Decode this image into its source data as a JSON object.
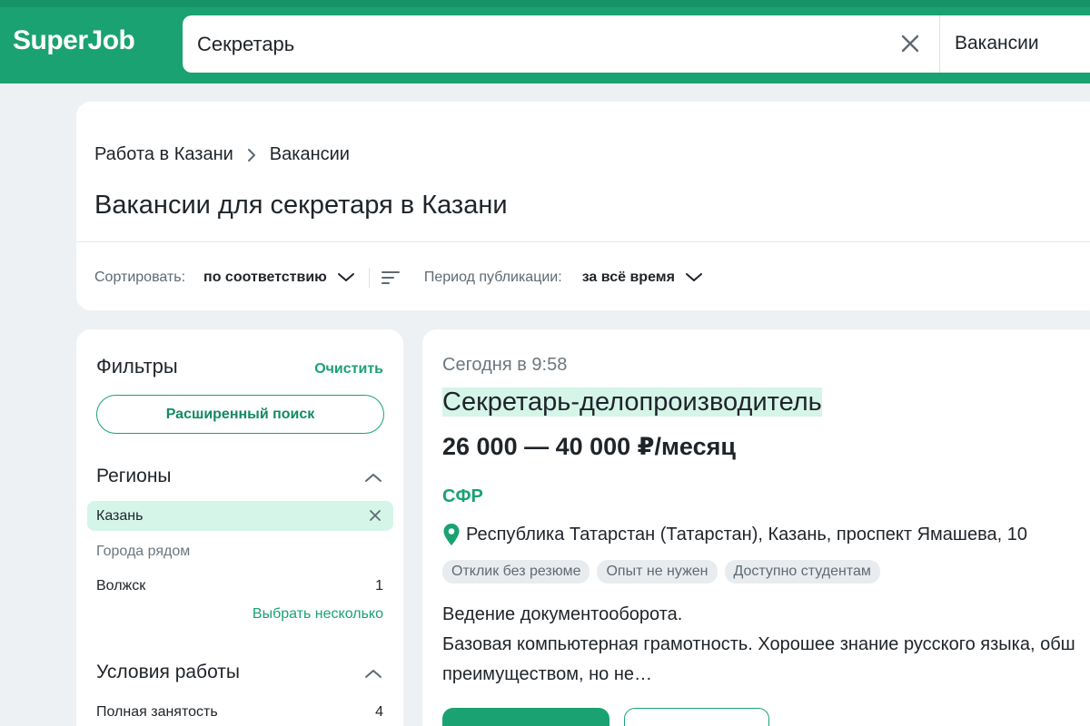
{
  "header": {
    "logo": "SuperJob",
    "search_value": "Секретарь",
    "search_type": "Вакансии"
  },
  "breadcrumb": {
    "items": [
      "Работа в Казани",
      "Вакансии"
    ]
  },
  "page_title": "Вакансии для секретаря в Казани",
  "sort": {
    "label": "Сортировать:",
    "value": "по соответствию",
    "period_label": "Период публикации:",
    "period_value": "за всё время"
  },
  "filters": {
    "title": "Фильтры",
    "clear": "Очистить",
    "advanced_search": "Расширенный поиск",
    "regions": {
      "title": "Регионы",
      "selected": "Казань",
      "nearby_label": "Города рядом",
      "cities": [
        {
          "name": "Волжск",
          "count": "1"
        }
      ],
      "choose_multiple": "Выбрать несколько"
    },
    "conditions": {
      "title": "Условия работы",
      "items": [
        {
          "name": "Полная занятость",
          "count": "4"
        }
      ]
    }
  },
  "vacancy": {
    "date": "Сегодня в 9:58",
    "title_part1": "Секретарь",
    "title_part2": "-делопроизводитель",
    "salary": "26 000 — 40 000 ₽/месяц",
    "company": "СФР",
    "address": "Республика Татарстан (Татарстан), Казань, проспект Ямашева, 10",
    "tags": [
      "Отклик без резюме",
      "Опыт не нужен",
      "Доступно студентам"
    ],
    "description_line1": "Ведение документооборота.",
    "description_line2": "Базовая компьютерная грамотность. Хорошее знание русского языка, обш",
    "description_line3": "преимуществом, но не…"
  },
  "colors": {
    "brand_green": "#1aa272",
    "highlight": "#d5f5e9",
    "background": "#eef1f3"
  }
}
